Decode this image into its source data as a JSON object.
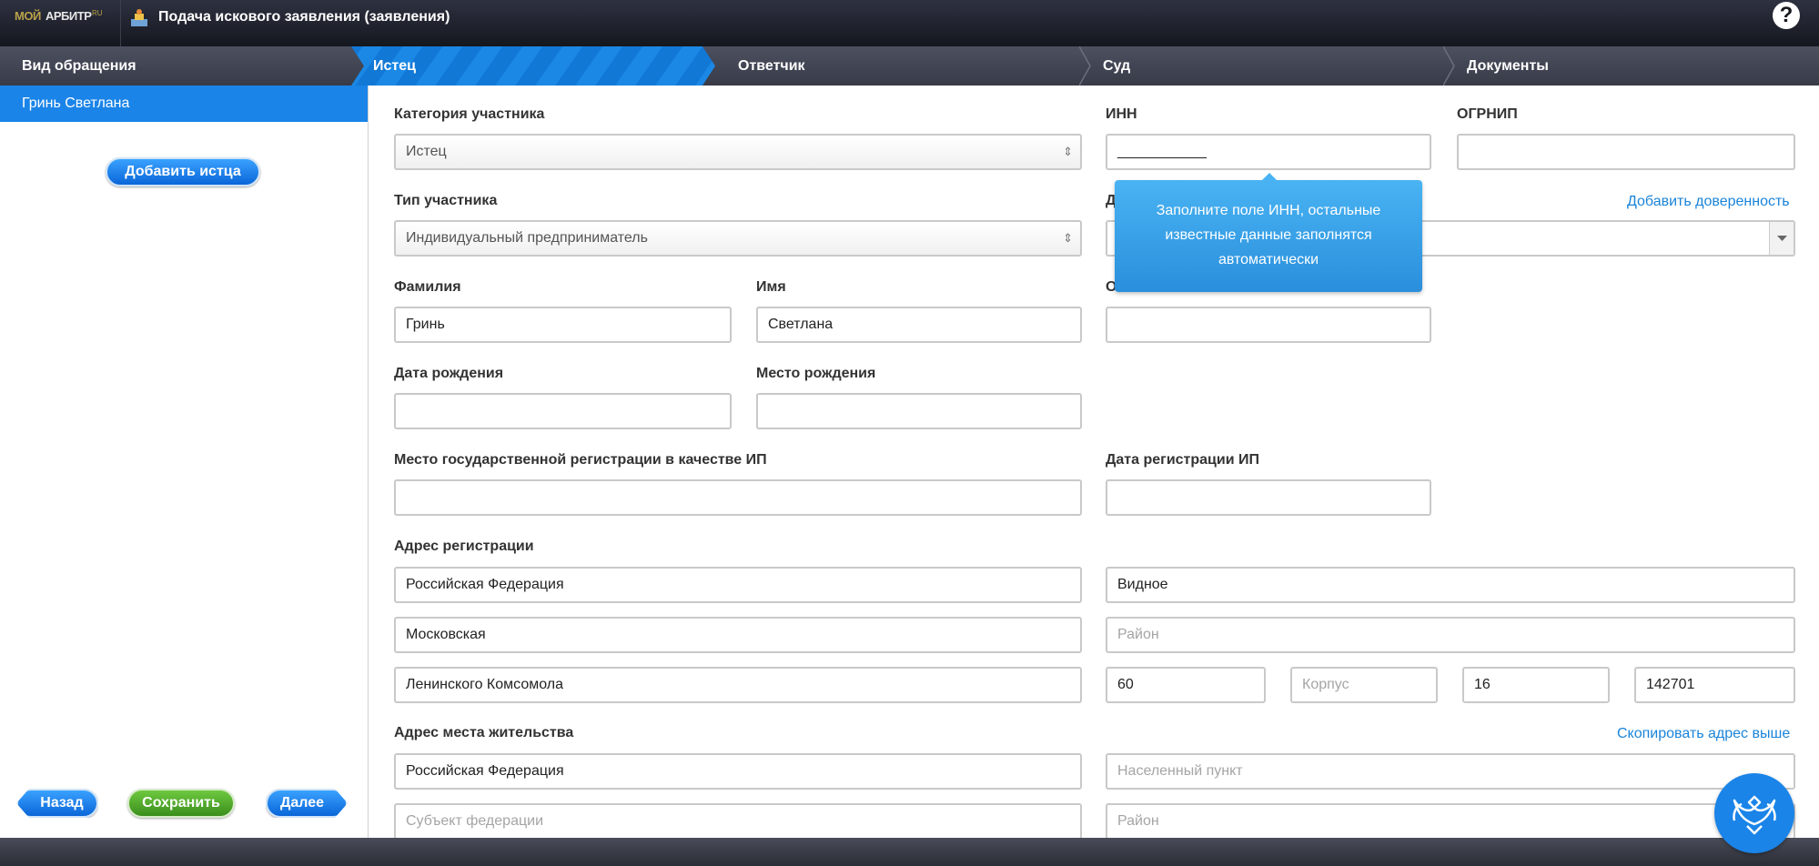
{
  "header": {
    "logo_part1": "МОЙ",
    "logo_part2": "АРБИТР",
    "logo_part3": "RU",
    "title": "Подача искового заявления (заявления)",
    "help_label": "?"
  },
  "steps": [
    {
      "label": "Вид обращения"
    },
    {
      "label": "Истец"
    },
    {
      "label": "Ответчик"
    },
    {
      "label": "Суд"
    },
    {
      "label": "Документы"
    }
  ],
  "sidebar": {
    "selected_plaintiff": "Гринь Светлана",
    "add_plaintiff": "Добавить истца",
    "back": "Назад",
    "save": "Сохранить",
    "next": "Далее"
  },
  "form": {
    "category_label": "Категория участника",
    "category_value": "Истец",
    "inn_label": "ИНН",
    "inn_value": "___________",
    "ogrnip_label": "ОГРНИП",
    "type_label": "Тип участника",
    "type_value": "Индивидуальный предприниматель",
    "power_label": "Д",
    "add_power": "Добавить доверенность",
    "surname_label": "Фамилия",
    "surname_value": "Гринь",
    "name_label": "Имя",
    "name_value": "Светлана",
    "patronymic_label": "Отчество",
    "birth_date_label": "Дата рождения",
    "birth_place_label": "Место рождения",
    "reg_place_label": "Место государственной регистрации в качестве ИП",
    "reg_date_label": "Дата регистрации ИП",
    "reg_address_label": "Адрес регистрации",
    "reg_country": "Российская Федерация",
    "reg_city": "Видное",
    "reg_region": "Московская",
    "reg_district_ph": "Район",
    "reg_street": "Ленинского Комсомола",
    "reg_house": "60",
    "reg_building_ph": "Корпус",
    "reg_flat": "16",
    "reg_zip": "142701",
    "live_address_label": "Адрес места жительства",
    "copy_address": "Скопировать адрес выше",
    "live_country": "Российская Федерация",
    "live_city_ph": "Населенный пункт",
    "live_region_ph": "Субъект федерации",
    "live_district_ph": "Район"
  },
  "tooltip": {
    "line1": "Заполните поле ИНН, остальные",
    "line2": "известные данные заполнятся",
    "line3": "автоматически"
  },
  "colors": {
    "accent": "#1a84e8",
    "green": "#4fa82a",
    "dark_bar": "#1e2029"
  }
}
